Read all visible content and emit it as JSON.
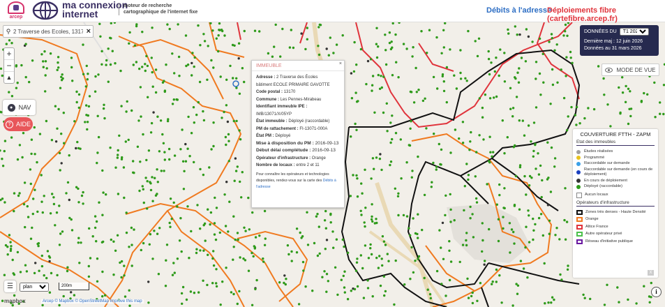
{
  "header": {
    "org_logo_text": "arcep",
    "brand_line1": "ma connexion",
    "brand_line2": "internet",
    "tagline_line1": "moteur de recherche",
    "tagline_line2": "cartographique de l'internet fixe",
    "link_debits": "Débits à l'adresse",
    "link_deploiements": "Déploiements fibre (cartefibre.arcep.fr)"
  },
  "search": {
    "value": "2 Traverse des Ecoles, 13170 Les Pennes-Mirabeau",
    "clear_label": "×"
  },
  "map_controls": {
    "zoom_in": "+",
    "zoom_out": "−",
    "compass": "▲",
    "nav_label": "NAV",
    "aide_label": "AIDE"
  },
  "data_panel": {
    "label": "DONNÉES DU",
    "period": "T1 2026",
    "last_update": "Dernière maj : 12 juin 2026",
    "data_date": "Données au 31 mars 2026"
  },
  "mode_vue_label": "MODE DE VUE",
  "popup": {
    "title": "IMMEUBLE",
    "close": "×",
    "adresse_label": "Adresse :",
    "adresse_value": "2 Traverse des Écoles",
    "adresse_value2": "bâtiment ECOLE PRIMAIRE GAVOTTE",
    "cp_label": "Code postal :",
    "cp_value": "13170",
    "commune_label": "Commune :",
    "commune_value": "Les Pennes-Mirabeau",
    "ipe_label": "Identifiant immeuble IPE :",
    "ipe_value": "IMB/13071/X/05YP",
    "etat_label": "État immeuble :",
    "etat_value": "Déployé (raccordable)",
    "pm_label": "PM de rattachement :",
    "pm_value": "FI-13071-000A",
    "etat_pm_label": "État PM :",
    "etat_pm_value": "Déployé",
    "mise_label": "Mise à disposition du PM :",
    "mise_value": "2016-09-13",
    "debut_label": "Début délai complétude :",
    "debut_value": "2016-09-13",
    "operateur_label": "Opérateur d'infrastructure :",
    "operateur_value": "Orange",
    "locaux_label": "Nombre de locaux :",
    "locaux_value": "entre 2 et 11",
    "note_text": "Pour connaître les opérateurs et technologies disponibles, rendez-vous sur la carte des",
    "note_link": "Débits à l'adresse"
  },
  "legend": {
    "title": "COUVERTURE FTTH - ZAPM",
    "section_etat": "Etat des immeubles",
    "etat_items": [
      {
        "label": "Études réalisées",
        "color": "#a0a0a0"
      },
      {
        "label": "Programmé",
        "color": "#e8c21c"
      },
      {
        "label": "Raccordable sur demande",
        "color": "#3aa0e8"
      },
      {
        "label": "Raccordable sur demande (en cours de déploiement)",
        "color": "#1a3fbf"
      },
      {
        "label": "En cours de déploiement",
        "color": "#333333"
      },
      {
        "label": "Déployé (raccordable)",
        "color": "#2e9a1a"
      }
    ],
    "aucun_locaux": "Aucun locaux",
    "section_operateurs": "Opérateurs d'infrastructure",
    "operateur_items": [
      {
        "label": "Zones très denses - Haute Densité",
        "color": "#111111"
      },
      {
        "label": "Orange",
        "color": "#f07a20"
      },
      {
        "label": "Altice France",
        "color": "#e0343c"
      },
      {
        "label": "Autre opérateur privé",
        "color": "#4cc14c"
      },
      {
        "label": "Réseau d'initiative publique",
        "color": "#6a1aa0"
      }
    ],
    "close_label": "X"
  },
  "bottom": {
    "plan_option": "plan",
    "scale_label": "200m",
    "mapbox": "mapbox",
    "attribution_arcep": "Arcep",
    "attribution_mapbox": "© Mapbox",
    "attribution_osm": "© OpenStreetMap",
    "attribution_improve": "Improve this map",
    "info_label": "i"
  },
  "colors": {
    "header_bg": "#ffffff",
    "dots_green": "#2e9a1a",
    "orange_zone": "#f07a20",
    "red_zone": "#e0343c",
    "black_zone": "#111111"
  }
}
